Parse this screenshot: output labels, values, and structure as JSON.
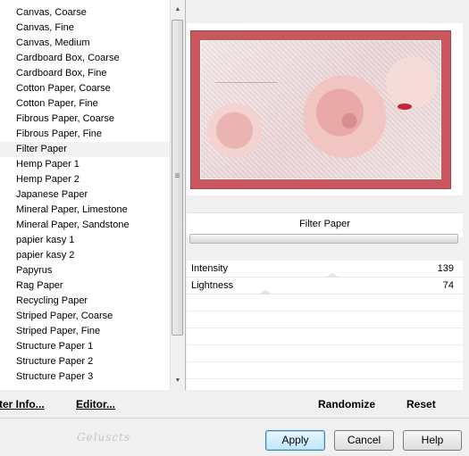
{
  "texture_list": {
    "selected": "Filter Paper",
    "items": [
      "Canvas, Coarse",
      "Canvas, Fine",
      "Canvas, Medium",
      "Cardboard Box, Coarse",
      "Cardboard Box, Fine",
      "Cotton Paper, Coarse",
      "Cotton Paper, Fine",
      "Fibrous Paper, Coarse",
      "Fibrous Paper, Fine",
      "Filter Paper",
      "Hemp Paper 1",
      "Hemp Paper 2",
      "Japanese Paper",
      "Mineral Paper, Limestone",
      "Mineral Paper, Sandstone",
      "papier kasy 1",
      "papier kasy 2",
      "Papyrus",
      "Rag Paper",
      "Recycling Paper",
      "Striped Paper, Coarse",
      "Striped Paper, Fine",
      "Structure Paper 1",
      "Structure Paper 2",
      "Structure Paper 3"
    ]
  },
  "left_actions": {
    "filter_info": "ter Info...",
    "editor": "Editor..."
  },
  "preview": {
    "filter_name": "Filter Paper",
    "progress_fraction": 1.0
  },
  "parameters": [
    {
      "label": "Intensity",
      "value": "139"
    },
    {
      "label": "Lightness",
      "value": "74"
    }
  ],
  "right_actions": {
    "randomize": "Randomize",
    "reset": "Reset"
  },
  "dialog_buttons": {
    "apply": "Apply",
    "cancel": "Cancel",
    "help": "Help"
  },
  "colors": {
    "frame": "#c8585e",
    "default_button_border": "#3c7fb1"
  }
}
